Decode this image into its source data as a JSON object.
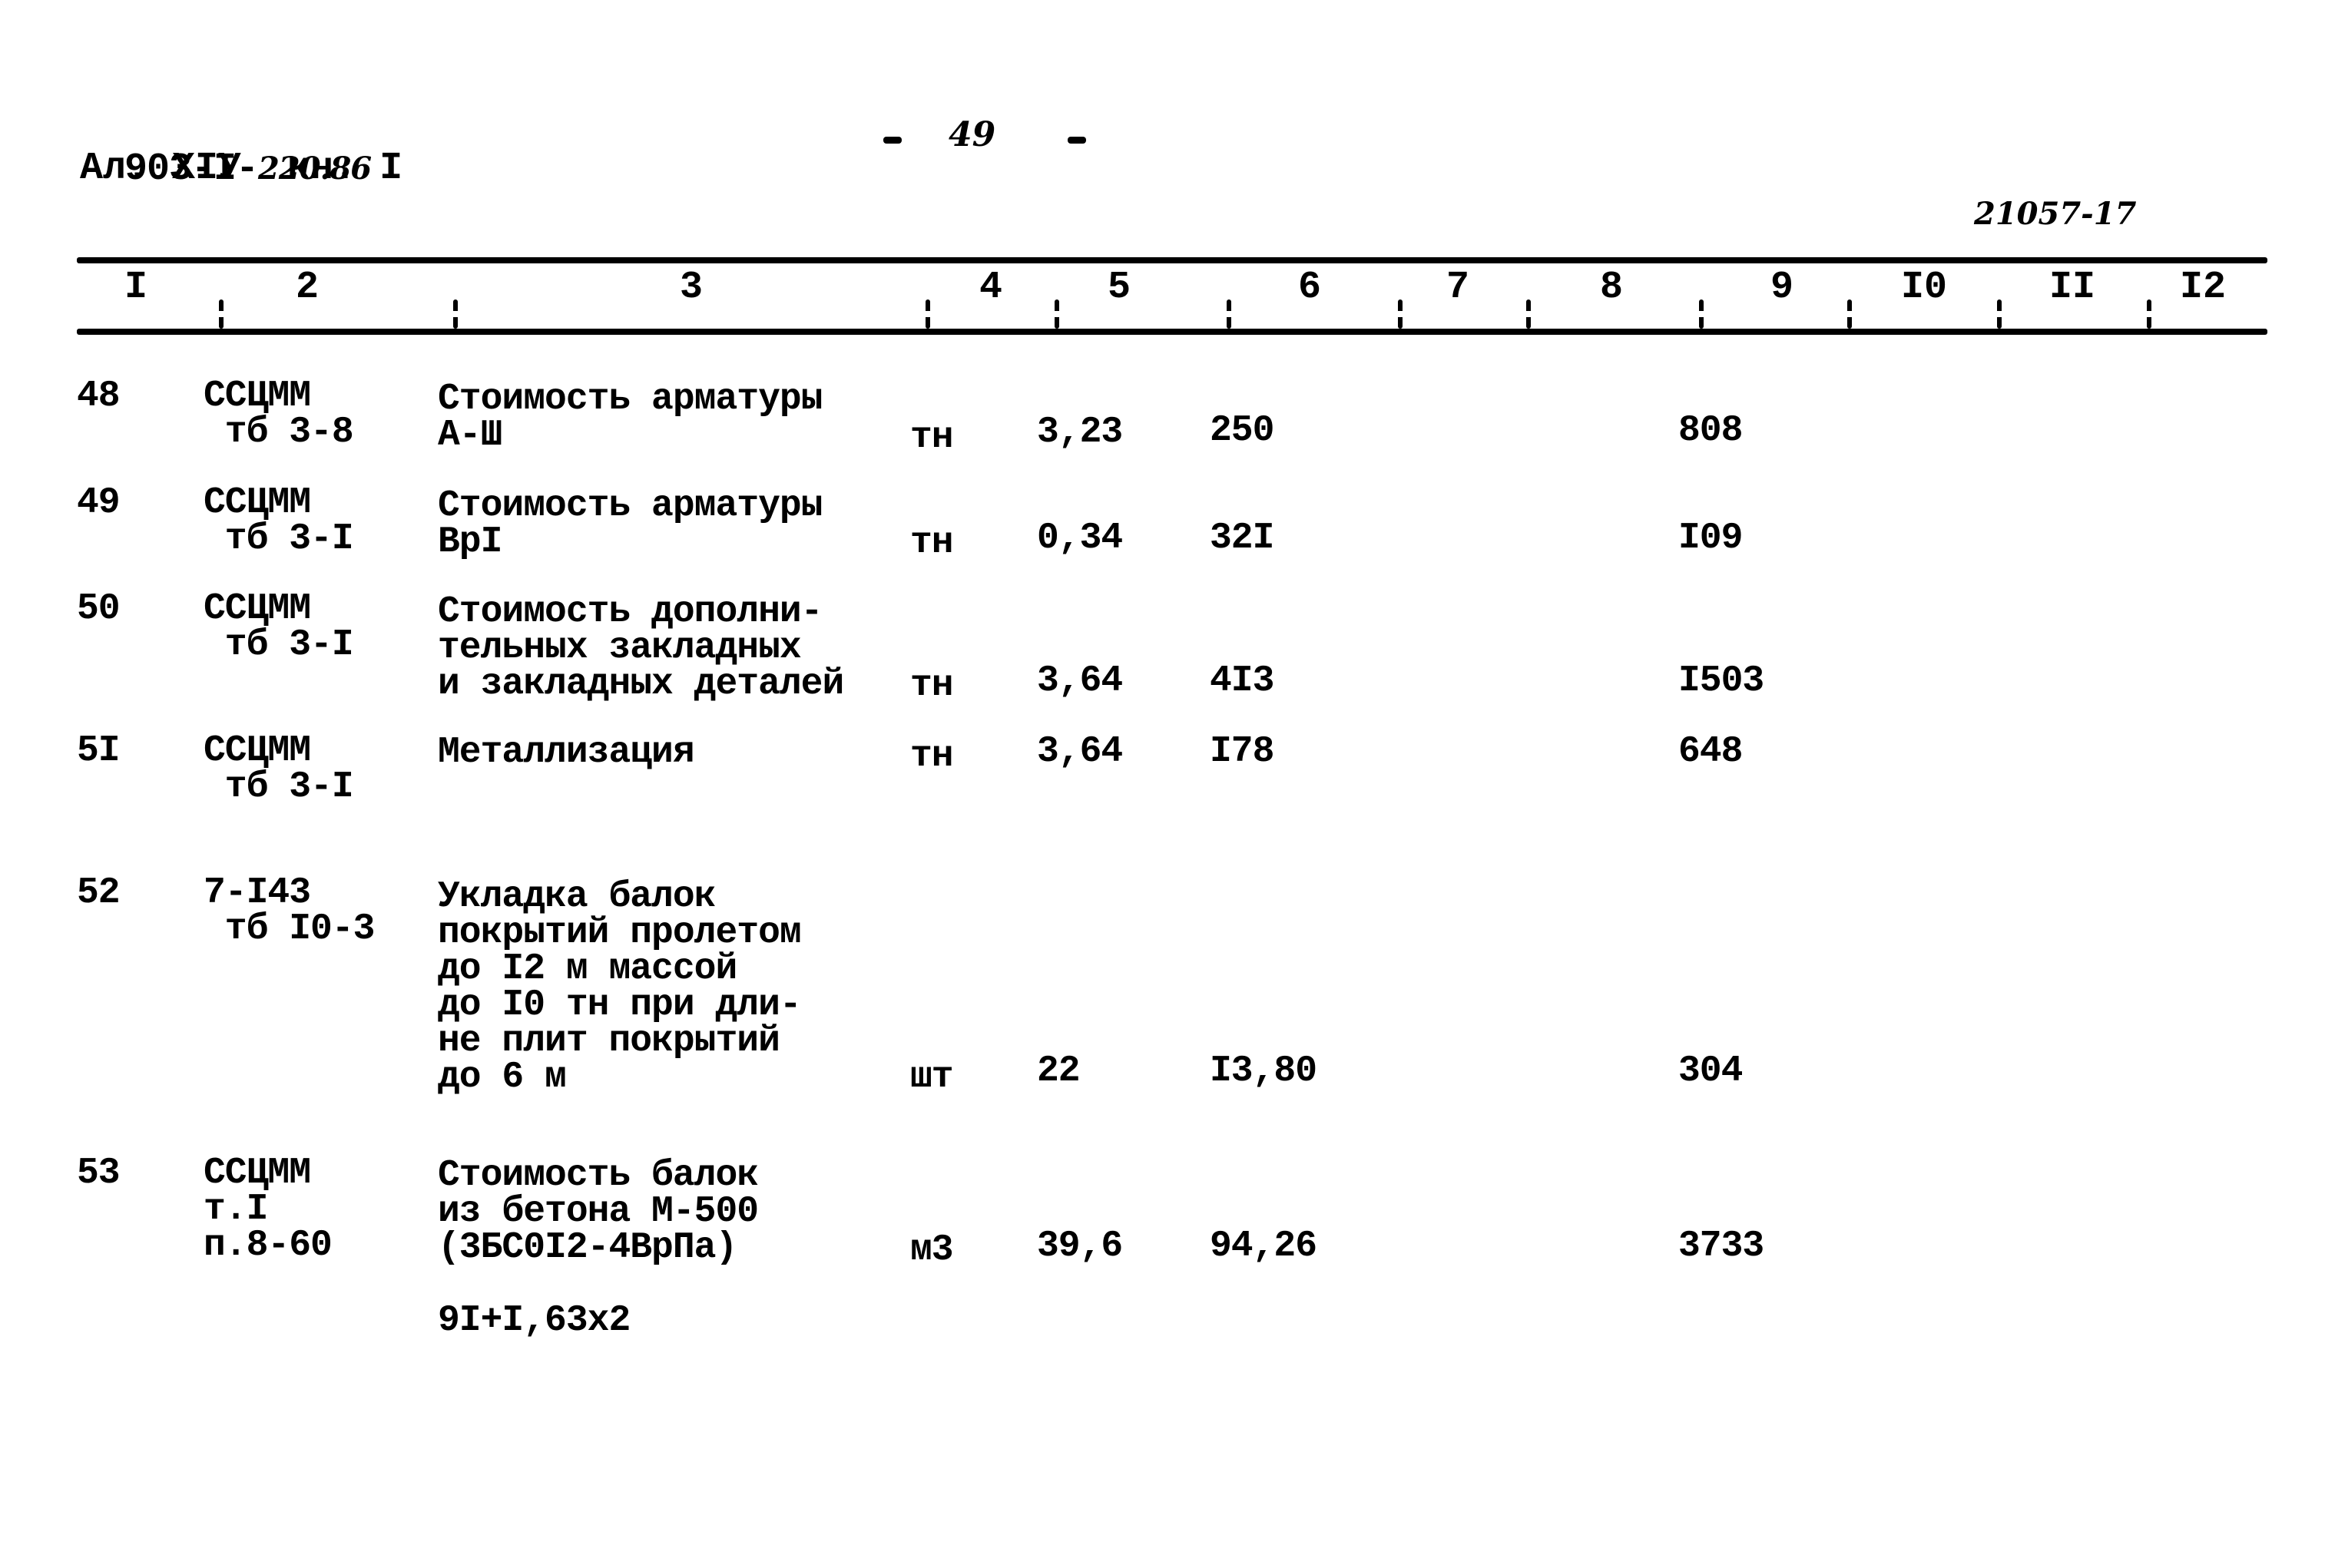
{
  "header": {
    "doc_code_printed": "903-I-",
    "doc_code_handwritten": "220.86",
    "volume": "Ал. XIУ  кн. I",
    "page_number": "49",
    "page_dash_left": "-",
    "page_dash_right": "-",
    "sheet_code": "21057-17"
  },
  "table": {
    "columns": [
      "I",
      "2",
      "3",
      "4",
      "5",
      "6",
      "7",
      "8",
      "9",
      "I0",
      "II",
      "I2"
    ],
    "rows": [
      {
        "num": "48",
        "ref": "ССЦММ\n тб 3-8",
        "description": "Стоимость арматуры\nА-Ш",
        "unit": "тн",
        "qty": "3,23",
        "price": "250",
        "total": "808"
      },
      {
        "num": "49",
        "ref": "ССЦММ\n тб 3-I",
        "description": "Стоимость арматуры\nВрI",
        "unit": "тн",
        "qty": "0,34",
        "price": "32I",
        "total": "I09"
      },
      {
        "num": "50",
        "ref": "ССЦММ\n тб 3-I",
        "description": "Стоимость дополни-\nтельных закладных\nи закладных деталей",
        "unit": "тн",
        "qty": "3,64",
        "price": "4I3",
        "total": "I503"
      },
      {
        "num": "5I",
        "ref": "ССЦММ\n тб 3-I",
        "description": "Металлизация",
        "unit": "тн",
        "qty": "3,64",
        "price": "I78",
        "total": "648"
      },
      {
        "num": "52",
        "ref": "7-I43\n тб I0-3",
        "description": "Укладка балок\nпокрытий пролетом\nдо I2 м массой\nдо I0 тн при дли-\nне плит покрытий\nдо 6 м",
        "unit": "шт",
        "qty": "22",
        "price": "I3,80",
        "total": "304"
      },
      {
        "num": "53",
        "ref": "ССЦММ\nт.I\nп.8-60",
        "description": "Стоимость балок\nиз бетона М-500\n(3БС0I2-4ВрПа)",
        "unit": "м3",
        "qty": "39,6",
        "price": "94,26",
        "total": "3733",
        "note": "9I+I,63х2"
      }
    ]
  }
}
